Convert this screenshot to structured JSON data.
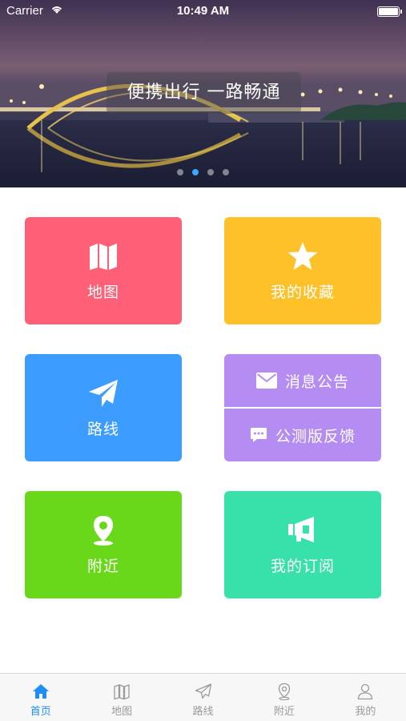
{
  "status_bar": {
    "carrier": "Carrier",
    "time": "10:49 AM"
  },
  "banner": {
    "slogan": "便携出行 一路畅通",
    "page_count": 4,
    "active_page": 2
  },
  "tiles": {
    "map": {
      "label": "地图",
      "icon": "map-icon",
      "color": "#ff6077"
    },
    "favorites": {
      "label": "我的收藏",
      "icon": "star-icon",
      "color": "#ffc12a"
    },
    "route": {
      "label": "路线",
      "icon": "paper-plane-icon",
      "color": "#3c9cff"
    },
    "notices": {
      "label": "消息公告",
      "icon": "envelope-icon",
      "color": "#b48cf2"
    },
    "feedback": {
      "label": "公测版反馈",
      "icon": "chat-bubble-icon",
      "color": "#b48cf2"
    },
    "nearby": {
      "label": "附近",
      "icon": "location-pin-icon",
      "color": "#6ad81a"
    },
    "subscriptions": {
      "label": "我的订阅",
      "icon": "megaphone-icon",
      "color": "#38e0aa"
    }
  },
  "tab_bar": {
    "active_color": "#1e8ef5",
    "items": [
      {
        "label": "首页",
        "icon": "home-icon",
        "active": true
      },
      {
        "label": "地图",
        "icon": "map-icon",
        "active": false
      },
      {
        "label": "路线",
        "icon": "paper-plane-icon",
        "active": false
      },
      {
        "label": "附近",
        "icon": "location-pin-icon",
        "active": false
      },
      {
        "label": "我的",
        "icon": "user-icon",
        "active": false
      }
    ]
  }
}
